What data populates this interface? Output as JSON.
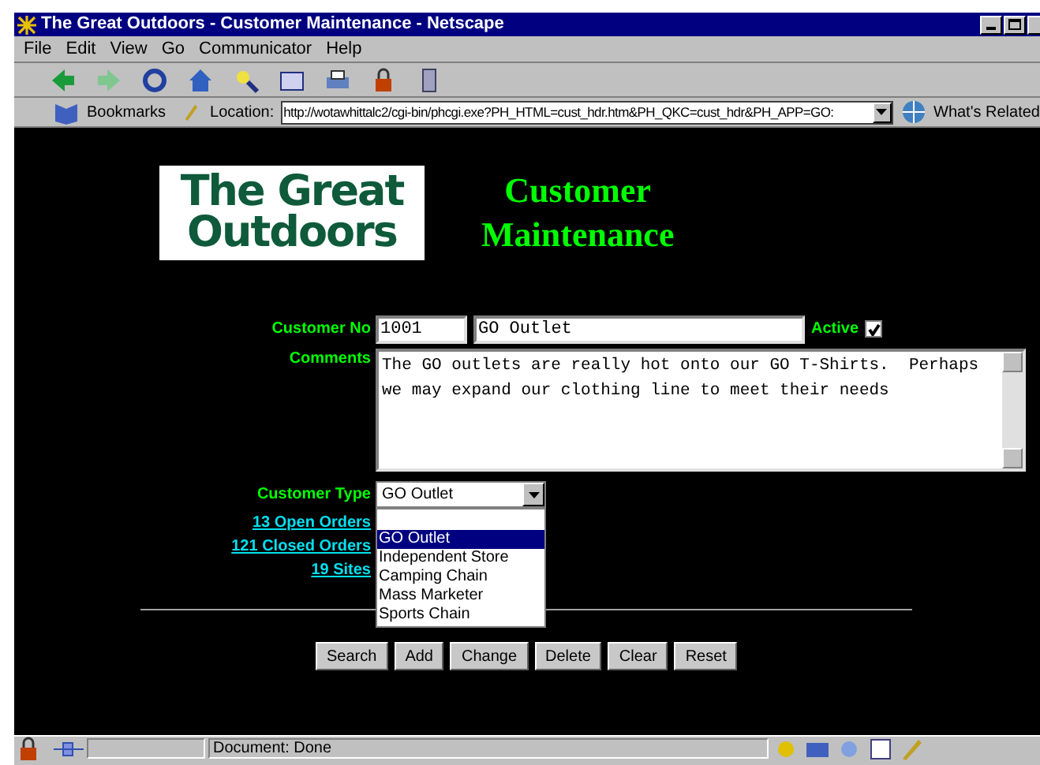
{
  "window": {
    "title": "The Great Outdoors - Customer Maintenance - Netscape"
  },
  "menu": [
    "File",
    "Edit",
    "View",
    "Go",
    "Communicator",
    "Help"
  ],
  "location_bar": {
    "bookmarks": "Bookmarks",
    "label": "Location:",
    "url": "http://wotawhittalc2/cgi-bin/phcgi.exe?PH_HTML=cust_hdr.htm&PH_QKC=cust_hdr&PH_APP=GO:",
    "related": "What's Related"
  },
  "logo": {
    "lines": [
      "The Great",
      "Outdoors"
    ]
  },
  "heading": [
    "Customer",
    "Maintenance"
  ],
  "form": {
    "customer_no_label": "Customer No",
    "customer_no": "1001",
    "customer_name": "GO Outlet",
    "active_label": "Active",
    "active": true,
    "comments_label": "Comments",
    "comments": "The GO outlets are really hot onto our GO T-Shirts.  Perhaps we may expand our clothing line to meet their needs",
    "customer_type_label": "Customer Type",
    "customer_type": "GO Outlet"
  },
  "dropdown_options": [
    {
      "label": "GO Outlet",
      "selected": true
    },
    {
      "label": "Independent Store",
      "selected": false
    },
    {
      "label": "Camping Chain",
      "selected": false
    },
    {
      "label": "Mass Marketer",
      "selected": false
    },
    {
      "label": "Sports Chain",
      "selected": false
    }
  ],
  "links": [
    "13 Open Orders",
    "121 Closed Orders",
    "19 Sites"
  ],
  "buttons": [
    "Search",
    "Add",
    "Change",
    "Delete",
    "Clear",
    "Reset"
  ],
  "status_bar": {
    "text": "Document: Done"
  }
}
